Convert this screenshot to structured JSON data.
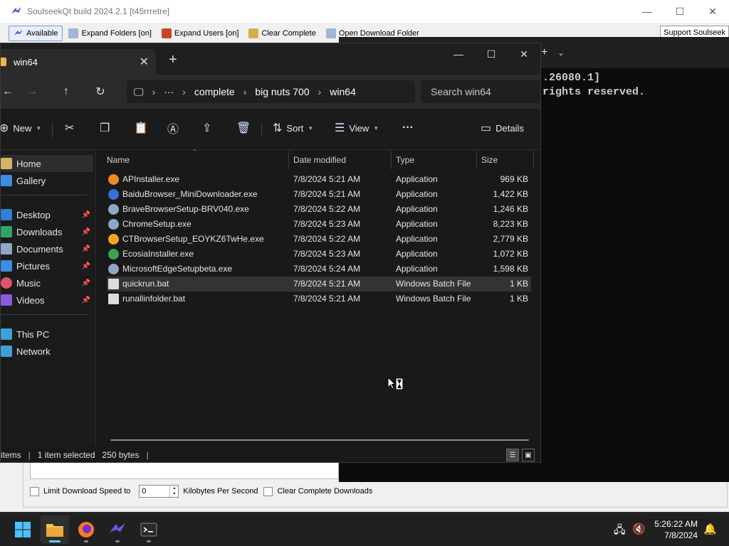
{
  "soulseek": {
    "title": "SoulseekQt build 2024.2.1 [t45rrretre]",
    "toolbar": {
      "status": "Available",
      "expand_folders": "Expand Folders [on]",
      "expand_users": "Expand Users [on]",
      "clear_complete": "Clear Complete",
      "open_download_folder": "Open Download Folder",
      "support": "Support Soulseek"
    },
    "options": {
      "limit_speed_label": "Limit Download Speed to",
      "limit_speed_value": "0",
      "unit_label": "Kilobytes Per Second",
      "clear_complete_downloads": "Clear Complete Downloads"
    }
  },
  "terminal": {
    "line1": ".26080.1]",
    "line2": "rights reserved."
  },
  "explorer": {
    "tab_title": "win64",
    "breadcrumb": [
      "complete",
      "big nuts 700",
      "win64"
    ],
    "breadcrumb_more": "···",
    "search_placeholder": "Search win64",
    "commands": {
      "new": "New",
      "sort": "Sort",
      "view": "View",
      "more": "···",
      "details": "Details"
    },
    "sidebar": {
      "home": "Home",
      "gallery": "Gallery",
      "desktop": "Desktop",
      "downloads": "Downloads",
      "documents": "Documents",
      "pictures": "Pictures",
      "music": "Music",
      "videos": "Videos",
      "this_pc": "This PC",
      "network": "Network"
    },
    "columns": {
      "name": "Name",
      "date": "Date modified",
      "type": "Type",
      "size": "Size"
    },
    "files": [
      {
        "name": "APInstaller.exe",
        "date": "7/8/2024 5:21 AM",
        "type": "Application",
        "size": "969 KB",
        "icon_color": "#f08a24"
      },
      {
        "name": "BaiduBrowser_MiniDownloader.exe",
        "date": "7/8/2024 5:21 AM",
        "type": "Application",
        "size": "1,422 KB",
        "icon_color": "#3a6fd8"
      },
      {
        "name": "BraveBrowserSetup-BRV040.exe",
        "date": "7/8/2024 5:22 AM",
        "type": "Application",
        "size": "1,246 KB",
        "icon_color": "#8fa6c8"
      },
      {
        "name": "ChromeSetup.exe",
        "date": "7/8/2024 5:23 AM",
        "type": "Application",
        "size": "8,223 KB",
        "icon_color": "#8fa6c8"
      },
      {
        "name": "CTBrowserSetup_EOYKZ6TwHe.exe",
        "date": "7/8/2024 5:22 AM",
        "type": "Application",
        "size": "2,779 KB",
        "icon_color": "#f5a623"
      },
      {
        "name": "EcosiaInstaller.exe",
        "date": "7/8/2024 5:23 AM",
        "type": "Application",
        "size": "1,072 KB",
        "icon_color": "#3fa34d"
      },
      {
        "name": "MicrosoftEdgeSetupbeta.exe",
        "date": "7/8/2024 5:24 AM",
        "type": "Application",
        "size": "1,598 KB",
        "icon_color": "#8fa6c8"
      },
      {
        "name": "quickrun.bat",
        "date": "7/8/2024 5:21 AM",
        "type": "Windows Batch File",
        "size": "1 KB",
        "icon_color": "#dcdcdc"
      },
      {
        "name": "runallinfolder.bat",
        "date": "7/8/2024 5:21 AM",
        "type": "Windows Batch File",
        "size": "1 KB",
        "icon_color": "#dcdcdc"
      }
    ],
    "selected_index": 7,
    "status": {
      "items": "items",
      "selected": "1 item selected",
      "bytes": "250 bytes"
    }
  },
  "taskbar": {
    "time": "5:26:22 AM",
    "date": "7/8/2024"
  },
  "colors": {
    "explorer_bg": "#191919",
    "accent": "#60cdff",
    "folder": "#e8b84a"
  }
}
